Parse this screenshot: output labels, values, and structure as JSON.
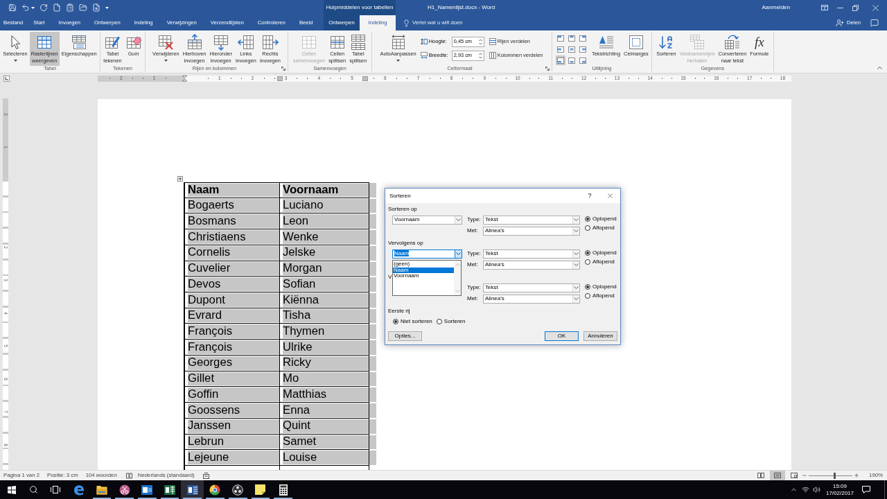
{
  "window": {
    "title": "H1_Namenlijst.docx - Word",
    "context_label": "Hulpmiddelen voor tabellen",
    "account": "Aanmelden"
  },
  "tabs": [
    {
      "label": "Bestand",
      "kind": "file",
      "selected": false
    },
    {
      "label": "Start",
      "kind": "main",
      "selected": false
    },
    {
      "label": "Invoegen",
      "kind": "main",
      "selected": false
    },
    {
      "label": "Ontwerpen",
      "kind": "main",
      "selected": false
    },
    {
      "label": "Indeling",
      "kind": "main",
      "selected": false
    },
    {
      "label": "Verwijzingen",
      "kind": "main",
      "selected": false
    },
    {
      "label": "Verzendlijsten",
      "kind": "main",
      "selected": false
    },
    {
      "label": "Controleren",
      "kind": "main",
      "selected": false
    },
    {
      "label": "Beeld",
      "kind": "main",
      "selected": false
    },
    {
      "label": "Ontwerpen",
      "kind": "context",
      "selected": false
    },
    {
      "label": "Indeling",
      "kind": "context",
      "selected": true
    }
  ],
  "tell_me": {
    "placeholder": "Vertel wat u wilt doen"
  },
  "share": {
    "label": "Delen"
  },
  "ribbon": {
    "groups": [
      {
        "label": "Tabel",
        "launcher": false,
        "items": [
          {
            "kind": "menu",
            "label": "Selecteren",
            "selected": false,
            "disabled": false
          },
          {
            "kind": "large",
            "label": "Rasterlijnen weergeven",
            "selected": true,
            "disabled": false
          },
          {
            "kind": "large",
            "label": "Eigenschappen",
            "selected": false,
            "disabled": false
          }
        ]
      },
      {
        "label": "Tekenen",
        "launcher": false,
        "items": [
          {
            "kind": "large",
            "label": "Tabel tekenen",
            "selected": false,
            "disabled": false
          },
          {
            "kind": "large",
            "label": "Gum",
            "selected": false,
            "disabled": false
          }
        ]
      },
      {
        "label": "Rijen en kolommen",
        "launcher": true,
        "items": [
          {
            "kind": "menu",
            "label": "Verwijderen",
            "selected": false,
            "disabled": false
          },
          {
            "kind": "large",
            "label": "Hierboven invoegen",
            "selected": false,
            "disabled": false
          },
          {
            "kind": "large",
            "label": "Hieronder invoegen",
            "selected": false,
            "disabled": false
          },
          {
            "kind": "large",
            "label": "Links invoegen",
            "selected": false,
            "disabled": false
          },
          {
            "kind": "large",
            "label": "Rechts invoegen",
            "selected": false,
            "disabled": false
          }
        ]
      },
      {
        "label": "Samenvoegen",
        "launcher": false,
        "items": [
          {
            "kind": "large",
            "label": "Cellen samenvoegen",
            "selected": false,
            "disabled": true
          },
          {
            "kind": "large",
            "label": "Cellen splitsen",
            "selected": false,
            "disabled": false
          },
          {
            "kind": "large",
            "label": "Tabel splitsen",
            "selected": false,
            "disabled": false
          }
        ]
      },
      {
        "label": "Celformaat",
        "launcher": true,
        "items": [
          {
            "kind": "menu",
            "label": "AutoAanpassen",
            "selected": false,
            "disabled": false
          },
          {
            "kind": "fields",
            "fields": [
              {
                "label": "Hoogte:",
                "value": "0,45 cm"
              },
              {
                "label": "Breedte:",
                "value": "2,93 cm"
              }
            ]
          },
          {
            "kind": "small",
            "buttons": [
              {
                "label": "Rijen verdelen"
              },
              {
                "label": "Kolommen verdelen"
              }
            ]
          }
        ]
      },
      {
        "label": "Uitlijning",
        "launcher": false,
        "items": [
          {
            "kind": "align",
            "cells": [
              {
                "selected": false
              },
              {
                "selected": false
              },
              {
                "selected": false
              },
              {
                "selected": false
              },
              {
                "selected": false
              },
              {
                "selected": false
              },
              {
                "selected": true
              },
              {
                "selected": false
              },
              {
                "selected": false
              }
            ]
          },
          {
            "kind": "large",
            "label": "Tekstrichting",
            "selected": false,
            "disabled": false
          },
          {
            "kind": "large",
            "label": "Celmarges",
            "selected": false,
            "disabled": false
          }
        ]
      },
      {
        "label": "Gegevens",
        "launcher": false,
        "items": [
          {
            "kind": "large",
            "label": "Sorteren",
            "selected": false,
            "disabled": false
          },
          {
            "kind": "large",
            "label": "Veldnamenrijen herhalen",
            "selected": false,
            "disabled": true
          },
          {
            "kind": "large",
            "label": "Converteren naar tekst",
            "selected": false,
            "disabled": false
          },
          {
            "kind": "large",
            "label": "Formule",
            "glyph": "fx",
            "selected": false,
            "disabled": false
          }
        ]
      }
    ]
  },
  "document": {
    "ruler": {
      "left_labels": [
        "2",
        "1"
      ],
      "right_labels": [
        "1",
        "2",
        "3",
        "4",
        "5",
        "6",
        "7",
        "8",
        "9",
        "10",
        "11",
        "12",
        "13",
        "14",
        "15",
        "16",
        "17",
        "18"
      ]
    },
    "vertical_ruler": {
      "top_labels": [
        "2",
        "1"
      ],
      "labels": [
        "2",
        "3",
        "4",
        "5",
        "6",
        "7",
        "8"
      ]
    },
    "table": {
      "selected": true,
      "columns": [
        "Naam",
        "Voornaam"
      ],
      "rows": [
        [
          "Bogaerts",
          "Luciano"
        ],
        [
          "Bosmans",
          "Leon"
        ],
        [
          "Christiaens",
          "Wenke"
        ],
        [
          "Cornelis",
          "Jelske"
        ],
        [
          "Cuvelier",
          "Morgan"
        ],
        [
          "Devos",
          "Sofian"
        ],
        [
          "Dupont",
          "Kiënna"
        ],
        [
          "Evrard",
          "Tisha"
        ],
        [
          "François",
          "Thymen"
        ],
        [
          "François",
          "Ulrike"
        ],
        [
          "Georges",
          "Ricky"
        ],
        [
          "Gillet",
          "Mo"
        ],
        [
          "Goffin",
          "Matthias"
        ],
        [
          "Goossens",
          "Enna"
        ],
        [
          "Janssen",
          "Quint"
        ],
        [
          "Lebrun",
          "Samet"
        ],
        [
          "Lejeune",
          "Louise"
        ]
      ]
    }
  },
  "dialog": {
    "title": "Sorteren",
    "help": "?",
    "sections": [
      {
        "label": "Sorteren op",
        "key": "Voornaam",
        "focused": false,
        "expanded": false,
        "type_label": "Type:",
        "type": "Tekst",
        "using_label": "Met:",
        "using": "Alinea's",
        "order": [
          {
            "label": "Oplopend",
            "selected": true
          },
          {
            "label": "Aflopend",
            "selected": false
          }
        ]
      },
      {
        "label": "Vervolgens op",
        "key": "Naam",
        "focused": true,
        "expanded": true,
        "options": [
          {
            "label": "(geen)",
            "selected": false
          },
          {
            "label": "Naam",
            "selected": true
          },
          {
            "label": "Voornaam",
            "selected": false
          }
        ],
        "type_label": "Type:",
        "type": "Tekst",
        "using_label": "Met:",
        "using": "Alinea's",
        "order": [
          {
            "label": "Oplopend",
            "selected": true
          },
          {
            "label": "Aflopend",
            "selected": false
          }
        ]
      },
      {
        "label": "V",
        "type_label": "Type:",
        "type": "Tekst",
        "using_label": "Met:",
        "using": "Alinea's",
        "order": [
          {
            "label": "Oplopend",
            "selected": true
          },
          {
            "label": "Aflopend",
            "selected": false
          }
        ]
      }
    ],
    "header_row": {
      "label": "Eerste rij",
      "options": [
        {
          "label": "Niet sorteren",
          "selected": true
        },
        {
          "label": "Sorteren",
          "selected": false
        }
      ]
    },
    "buttons": [
      {
        "label": "Opties...",
        "default": false
      },
      {
        "label": "OK",
        "default": true
      },
      {
        "label": "Annuleren",
        "default": false
      }
    ]
  },
  "status_bar": {
    "items": [
      "Pagina 1 van 2",
      "Positie: 3 cm",
      "104 woorden"
    ],
    "language": "Nederlands (standaard)",
    "views": [
      {
        "selected": false
      },
      {
        "selected": true
      },
      {
        "selected": false
      }
    ],
    "zoom": {
      "level": 0.58,
      "label": "190%"
    }
  },
  "taskbar": {
    "apps": [
      {
        "running": false,
        "selected": false
      },
      {
        "running": true,
        "selected": false
      },
      {
        "running": true,
        "selected": false
      },
      {
        "running": true,
        "selected": false
      },
      {
        "running": true,
        "selected": false
      },
      {
        "running": true,
        "selected": true
      },
      {
        "running": true,
        "selected": false
      },
      {
        "running": true,
        "selected": false
      },
      {
        "running": true,
        "selected": false
      },
      {
        "running": true,
        "selected": false
      }
    ],
    "time": "15:09",
    "date": "17/02/2017"
  }
}
